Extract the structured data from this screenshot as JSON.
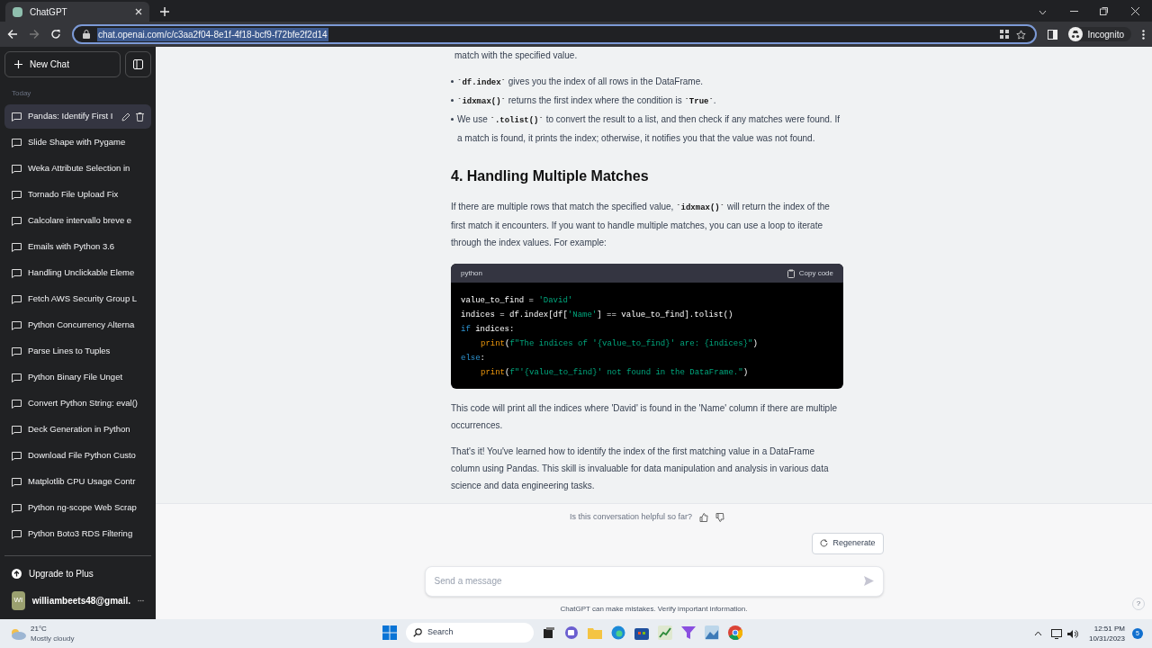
{
  "browser": {
    "tab_title": "ChatGPT",
    "url": "chat.openai.com/c/c3aa2f04-8e1f-4f18-bcf9-f72bfe2f2d14",
    "profile": "Incognito"
  },
  "sidebar": {
    "new_chat": "New Chat",
    "section": "Today",
    "items": [
      {
        "title": "Pandas: Identify First I",
        "selected": true
      },
      {
        "title": "Slide Shape with Pygame",
        "selected": false
      },
      {
        "title": "Weka Attribute Selection in",
        "selected": false
      },
      {
        "title": "Tornado File Upload Fix",
        "selected": false
      },
      {
        "title": "Calcolare intervallo breve e",
        "selected": false
      },
      {
        "title": "Emails with Python 3.6",
        "selected": false
      },
      {
        "title": "Handling Unclickable Eleme",
        "selected": false
      },
      {
        "title": "Fetch AWS Security Group L",
        "selected": false
      },
      {
        "title": "Python Concurrency Alterna",
        "selected": false
      },
      {
        "title": "Parse Lines to Tuples",
        "selected": false
      },
      {
        "title": "Python Binary File Unget",
        "selected": false
      },
      {
        "title": "Convert Python String: eval()",
        "selected": false
      },
      {
        "title": "Deck Generation in Python",
        "selected": false
      },
      {
        "title": "Download File Python Custo",
        "selected": false
      },
      {
        "title": "Matplotlib CPU Usage Contr",
        "selected": false
      },
      {
        "title": "Python ng-scope Web Scrap",
        "selected": false
      },
      {
        "title": "Python Boto3 RDS Filtering",
        "selected": false
      }
    ],
    "upgrade": "Upgrade to Plus",
    "user_initials": "WI",
    "user_email": "williambeets48@gmail."
  },
  "content": [
    {
      "kind": "paragraph",
      "indent": true,
      "segments": [
        {
          "kind": "text",
          "text": "match with the specified value."
        }
      ]
    },
    {
      "kind": "bullet",
      "segments": [
        {
          "kind": "code",
          "text": "`df.index`"
        },
        {
          "kind": "text",
          "text": " gives you the index of all rows in the DataFrame."
        }
      ]
    },
    {
      "kind": "bullet",
      "segments": [
        {
          "kind": "code",
          "text": "`idxmax()`"
        },
        {
          "kind": "text",
          "text": " returns the first index where the condition is "
        },
        {
          "kind": "code",
          "text": "`True`"
        },
        {
          "kind": "text",
          "text": "."
        }
      ]
    },
    {
      "kind": "bullet",
      "segments": [
        {
          "kind": "text",
          "text": "We use "
        },
        {
          "kind": "code",
          "text": "`.tolist()`"
        },
        {
          "kind": "text",
          "text": " to convert the result to a list, and then check if any matches were found. If a match is found, it prints the index; otherwise, it notifies you that the value was not found."
        }
      ]
    },
    {
      "kind": "heading",
      "segments": [
        {
          "kind": "text",
          "text": "4. Handling Multiple Matches"
        }
      ]
    },
    {
      "kind": "paragraph",
      "segments": [
        {
          "kind": "text",
          "text": "If there are multiple rows that match the specified value, "
        },
        {
          "kind": "code",
          "text": "`idxmax()`"
        },
        {
          "kind": "text",
          "text": " will return the index of the first match it encounters. If you want to handle multiple matches, you can use a loop to iterate through the index values. For example:"
        }
      ]
    },
    {
      "kind": "code_block",
      "language": "python",
      "copy": "Copy code",
      "lines": [
        {
          "indent": false,
          "tokens": [
            {
              "kind": "plain",
              "text": "value_to_find = "
            },
            {
              "kind": "string",
              "text": "'David'"
            }
          ]
        },
        {
          "indent": false,
          "tokens": [
            {
              "kind": "plain",
              "text": "indices = df.index[df["
            },
            {
              "kind": "string",
              "text": "'Name'"
            },
            {
              "kind": "plain",
              "text": "] == value_to_find].tolist()"
            }
          ]
        },
        {
          "indent": false,
          "tokens": [
            {
              "kind": "keyword",
              "text": "if"
            },
            {
              "kind": "plain",
              "text": " indices:"
            }
          ]
        },
        {
          "indent": true,
          "tokens": [
            {
              "kind": "builtin",
              "text": "print"
            },
            {
              "kind": "plain",
              "text": "("
            },
            {
              "kind": "string",
              "text": "f\"The indices of '{value_to_find}' are: {indices}\""
            },
            {
              "kind": "plain",
              "text": ")"
            }
          ]
        },
        {
          "indent": false,
          "tokens": [
            {
              "kind": "keyword",
              "text": "else"
            },
            {
              "kind": "plain",
              "text": ":"
            }
          ]
        },
        {
          "indent": true,
          "tokens": [
            {
              "kind": "builtin",
              "text": "print"
            },
            {
              "kind": "plain",
              "text": "("
            },
            {
              "kind": "string",
              "text": "f\"'{value_to_find}' not found in the DataFrame.\""
            },
            {
              "kind": "plain",
              "text": ")"
            }
          ]
        }
      ]
    },
    {
      "kind": "paragraph",
      "segments": [
        {
          "kind": "text",
          "text": "This code will print all the indices where 'David' is found in the 'Name' column if there are multiple occurrences."
        }
      ]
    },
    {
      "kind": "paragraph",
      "segments": [
        {
          "kind": "text",
          "text": "That's it! You've learned how to identify the index of the first matching value in a DataFrame column using Pandas. This skill is invaluable for data manipulation and analysis in various data science and data engineering tasks."
        }
      ]
    }
  ],
  "feedback": "Is this conversation helpful so far?",
  "regenerate": "Regenerate",
  "composer": {
    "placeholder": "Send a message"
  },
  "disclaimer": "ChatGPT can make mistakes. Verify important information.",
  "help": "?",
  "taskbar": {
    "temperature": "21°C",
    "weather": "Mostly cloudy",
    "search": "Search",
    "time": "12:51 PM",
    "date": "10/31/2023",
    "notifications": "5"
  }
}
